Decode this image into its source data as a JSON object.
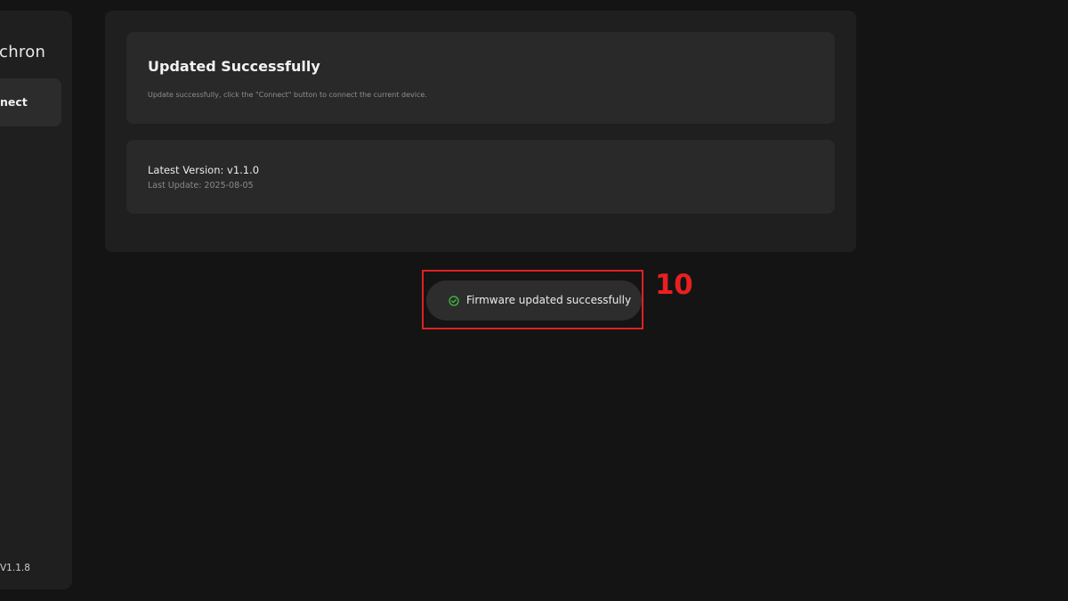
{
  "sidebar": {
    "brand": "chron",
    "nav_item_label": "nect",
    "app_version": "V1.1.8"
  },
  "status_card": {
    "title": "Updated Successfully",
    "description": "Update successfully, click the \"Connect\" button to connect the current device."
  },
  "version_card": {
    "latest_version": "Latest Version: v1.1.0",
    "last_update": "Last Update: 2025-08-05"
  },
  "toast": {
    "message": "Firmware updated successfully",
    "icon": "check-circle-icon",
    "icon_color": "#3ec63e"
  },
  "annotation": {
    "label": "10",
    "color": "#e02020"
  }
}
